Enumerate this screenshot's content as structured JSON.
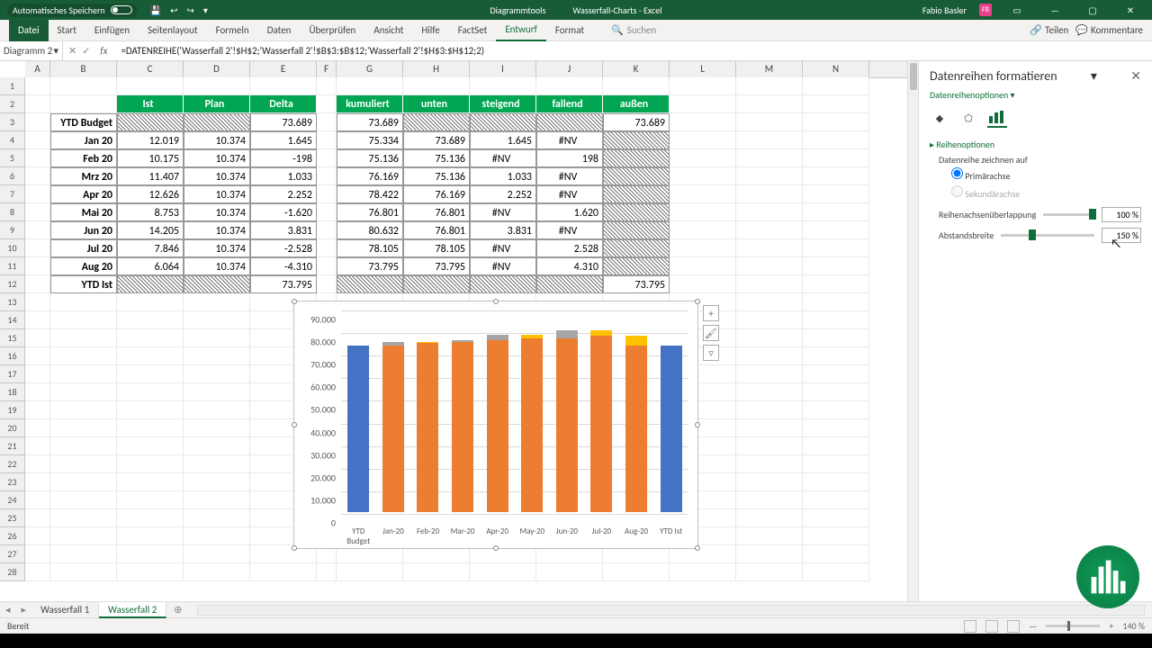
{
  "titlebar": {
    "autosave": "Automatisches Speichern",
    "center_tool": "Diagrammtools",
    "center_doc": "Wasserfall-Charts - Excel",
    "user": "Fabio Basler"
  },
  "ribbon": {
    "tabs": [
      "Datei",
      "Start",
      "Einfügen",
      "Seitenlayout",
      "Formeln",
      "Daten",
      "Überprüfen",
      "Ansicht",
      "Hilfe",
      "FactSet",
      "Entwurf",
      "Format"
    ],
    "search": "Suchen",
    "share": "Teilen",
    "comments": "Kommentare"
  },
  "namebox": "Diagramm 2",
  "formula": "=DATENREIHE('Wasserfall 2'!$H$2;'Wasserfall 2'!$B$3:$B$12;'Wasserfall 2'!$H$3:$H$12;2)",
  "columns": [
    "A",
    "B",
    "C",
    "D",
    "E",
    "F",
    "G",
    "H",
    "I",
    "J",
    "K",
    "L",
    "M",
    "N"
  ],
  "headers1": {
    "C": "Ist",
    "D": "Plan",
    "E": "Delta"
  },
  "headers2": {
    "G": "kumuliert",
    "H": "unten",
    "I": "steigend",
    "J": "fallend",
    "K": "außen"
  },
  "rows": [
    {
      "B": "YTD Budget",
      "C": "",
      "D": "",
      "E": "73.689",
      "G": "73.689",
      "H": "",
      "I": "",
      "J": "",
      "K": "73.689"
    },
    {
      "B": "Jan 20",
      "C": "12.019",
      "D": "10.374",
      "E": "1.645",
      "G": "75.334",
      "H": "73.689",
      "I": "1.645",
      "J": "#NV",
      "K": ""
    },
    {
      "B": "Feb 20",
      "C": "10.175",
      "D": "10.374",
      "E": "-198",
      "G": "75.136",
      "H": "75.136",
      "I": "#NV",
      "J": "198",
      "K": ""
    },
    {
      "B": "Mrz 20",
      "C": "11.407",
      "D": "10.374",
      "E": "1.033",
      "G": "76.169",
      "H": "75.136",
      "I": "1.033",
      "J": "#NV",
      "K": ""
    },
    {
      "B": "Apr 20",
      "C": "12.626",
      "D": "10.374",
      "E": "2.252",
      "G": "78.422",
      "H": "76.169",
      "I": "2.252",
      "J": "#NV",
      "K": ""
    },
    {
      "B": "Mai 20",
      "C": "8.753",
      "D": "10.374",
      "E": "-1.620",
      "G": "76.801",
      "H": "76.801",
      "I": "#NV",
      "J": "1.620",
      "K": ""
    },
    {
      "B": "Jun 20",
      "C": "14.205",
      "D": "10.374",
      "E": "3.831",
      "G": "80.632",
      "H": "76.801",
      "I": "3.831",
      "J": "#NV",
      "K": ""
    },
    {
      "B": "Jul 20",
      "C": "7.846",
      "D": "10.374",
      "E": "-2.528",
      "G": "78.105",
      "H": "78.105",
      "I": "#NV",
      "J": "2.528",
      "K": ""
    },
    {
      "B": "Aug 20",
      "C": "6.064",
      "D": "10.374",
      "E": "-4.310",
      "G": "73.795",
      "H": "73.795",
      "I": "#NV",
      "J": "4.310",
      "K": ""
    },
    {
      "B": "YTD Ist",
      "C": "",
      "D": "",
      "E": "73.795",
      "G": "",
      "H": "",
      "I": "",
      "J": "",
      "K": "73.795"
    }
  ],
  "chart_data": {
    "type": "bar",
    "categories": [
      "YTD Budget",
      "Jan-20",
      "Feb-20",
      "Mar-20",
      "Apr-20",
      "May-20",
      "Jun-20",
      "Jul-20",
      "Aug-20",
      "YTD Ist"
    ],
    "series": [
      {
        "name": "außen",
        "color": "#4472c4",
        "values": [
          73689,
          null,
          null,
          null,
          null,
          null,
          null,
          null,
          null,
          73795
        ]
      },
      {
        "name": "unten",
        "color": "#ed7d31",
        "values": [
          null,
          73689,
          75136,
          75136,
          76169,
          76801,
          76801,
          78105,
          73795,
          null
        ]
      },
      {
        "name": "steigend",
        "color": "#a5a5a5",
        "values": [
          null,
          1645,
          null,
          1033,
          2252,
          null,
          3831,
          null,
          null,
          null
        ]
      },
      {
        "name": "fallend",
        "color": "#ffc000",
        "values": [
          null,
          null,
          198,
          null,
          null,
          1620,
          null,
          2528,
          4310,
          null
        ]
      }
    ],
    "ylim": [
      0,
      90000
    ],
    "yticks": [
      0,
      10000,
      20000,
      30000,
      40000,
      50000,
      60000,
      70000,
      80000,
      90000
    ],
    "yticklabels": [
      "0",
      "10.000",
      "20.000",
      "30.000",
      "40.000",
      "50.000",
      "60.000",
      "70.000",
      "80.000",
      "90.000"
    ]
  },
  "taskpane": {
    "title": "Datenreihen formatieren",
    "dropdown": "Datenreihenoptionen",
    "section": "Reihenoptionen",
    "plot_on": "Datenreihe zeichnen auf",
    "radio1": "Primärachse",
    "radio2": "Sekundärachse",
    "overlap_label": "Reihenachsenüberlappung",
    "overlap_value": "100 %",
    "gap_label": "Abstandsbreite",
    "gap_value": "150 %"
  },
  "sheets": [
    "Wasserfall 1",
    "Wasserfall 2"
  ],
  "status": {
    "ready": "Bereit",
    "zoom": "140 %"
  }
}
